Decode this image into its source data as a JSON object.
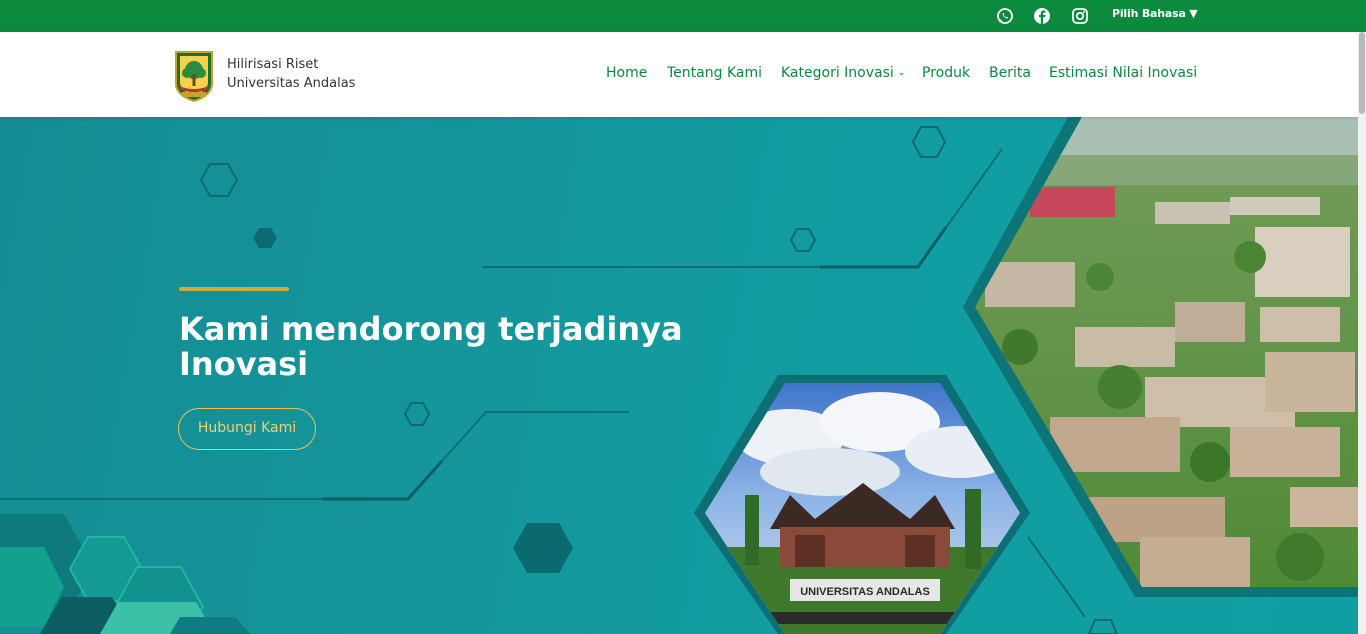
{
  "topbar": {
    "social": [
      {
        "icon": "whatsapp-icon"
      },
      {
        "icon": "facebook-icon"
      },
      {
        "icon": "instagram-icon"
      }
    ],
    "language_label": "Pilih Bahasa ▼"
  },
  "header": {
    "brand_line1": "Hilirisasi Riset",
    "brand_line2": "Universitas Andalas",
    "nav": [
      {
        "label": "Home"
      },
      {
        "label": "Tentang Kami"
      },
      {
        "label": "Kategori Inovasi"
      },
      {
        "label": "Produk"
      },
      {
        "label": "Berita"
      },
      {
        "label": "Estimasi Nilai Inovasi"
      }
    ]
  },
  "hero": {
    "headline_line1": "Kami mendorong terjadinya",
    "headline_line2": "Inovasi",
    "cta_label": "Hubungi Kami",
    "gate_sign": "UNIVERSITAS ANDALAS"
  },
  "colors": {
    "topbar": "#0b8a3e",
    "nav_text": "#0b8a3e",
    "hero_teal": "#119da1",
    "accent_gold": "#d4a935"
  }
}
